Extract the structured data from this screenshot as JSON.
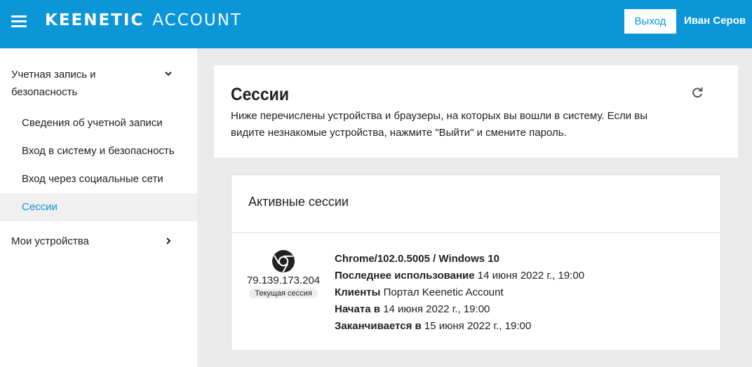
{
  "header": {
    "brand": "KEENETIC",
    "brand_sub": "ACCOUNT",
    "logout_label": "Выход",
    "user_name": "Иван Серов"
  },
  "sidebar": {
    "group_label": "Учетная запись и безопасность",
    "items": [
      {
        "label": "Сведения об учетной записи",
        "active": false
      },
      {
        "label": "Вход в систему и безопасность",
        "active": false
      },
      {
        "label": "Вход через социальные сети",
        "active": false
      },
      {
        "label": "Сессии",
        "active": true
      }
    ],
    "devices_label": "Мои устройства"
  },
  "page": {
    "title": "Сессии",
    "description": "Ниже перечислены устройства и браузеры, на которых вы вошли в систему. Если вы видите незнакомые устройства, нажмите \"Выйти\" и смените пароль."
  },
  "sessions": {
    "title": "Активные сессии",
    "items": [
      {
        "icon": "chrome-icon",
        "ip": "79.139.173.204",
        "badge": "Текущая сессия",
        "browser": "Chrome/102.0.5005 / Windows 10",
        "last_used_label": "Последнее использование",
        "last_used": "14 июня 2022 г., 19:00",
        "clients_label": "Клиенты",
        "clients": "Портал Keenetic Account",
        "started_label": "Начата в",
        "started": "14 июня 2022 г., 19:00",
        "ends_label": "Заканчивается в",
        "ends": "15 июня 2022 г., 19:00"
      }
    ]
  },
  "colors": {
    "accent": "#0b96d8",
    "background": "#ebebeb",
    "active_item_bg": "#f0f0f0"
  }
}
